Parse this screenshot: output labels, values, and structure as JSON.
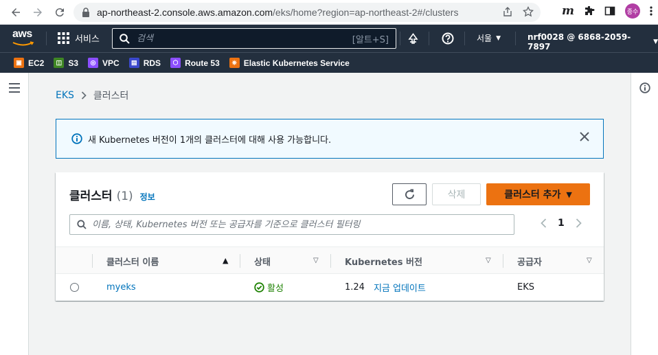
{
  "browser": {
    "url_domain": "ap-northeast-2.console.aws.amazon.com",
    "url_path": "/eks/home?region=ap-northeast-2#/clusters",
    "avatar_label": "종수"
  },
  "aws_nav": {
    "logo": "aws",
    "services_label": "서비스",
    "search_placeholder": "검색",
    "search_hint": "[알트+S]",
    "region_label": "서울",
    "account_label": "nrf0028 @ 6868-2059-7897"
  },
  "favorites": [
    {
      "label": "EC2",
      "color": "#ec7211"
    },
    {
      "label": "S3",
      "color": "#3f8624"
    },
    {
      "label": "VPC",
      "color": "#8c4fff"
    },
    {
      "label": "RDS",
      "color": "#3b48cc"
    },
    {
      "label": "Route 53",
      "color": "#8c4fff"
    },
    {
      "label": "Elastic Kubernetes Service",
      "color": "#ec7211"
    }
  ],
  "breadcrumb": {
    "root": "EKS",
    "current": "클러스터"
  },
  "flash": {
    "message": "새 Kubernetes 버전이 1개의 클러스터에 대해 사용 가능합니다."
  },
  "panel": {
    "title": "클러스터",
    "count": "(1)",
    "info_link": "정보",
    "delete_label": "삭제",
    "add_label": "클러스터 추가",
    "filter_placeholder": "이름, 상태, Kubernetes 버전 또는 공급자를 기준으로 클러스터 필터링",
    "page": "1"
  },
  "table": {
    "headers": [
      "클러스터 이름",
      "상태",
      "Kubernetes 버전",
      "공급자"
    ],
    "rows": [
      {
        "name": "myeks",
        "status": "활성",
        "version": "1.24",
        "update_link": "지금 업데이트",
        "provider": "EKS"
      }
    ]
  },
  "colors": {
    "accent": "#ec7211",
    "link": "#0073bb",
    "status_ok": "#1d8102",
    "nav_bg": "#232f3e"
  }
}
